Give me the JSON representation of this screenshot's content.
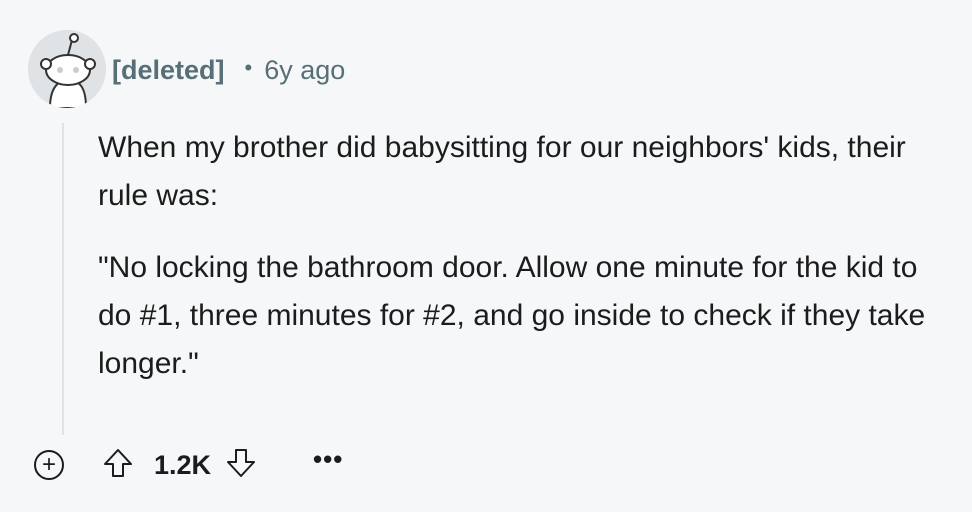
{
  "comment": {
    "author": "[deleted]",
    "separator": "•",
    "age": "6y ago",
    "paragraphs": [
      "When my brother did babysitting for our neighbors' kids, their rule was:",
      "\"No locking the bathroom door. Allow one minute for the kid to do #1, three minutes for #2, and go inside to check if they take longer.\""
    ],
    "score": "1.2K"
  },
  "actions": {
    "expand_symbol": "+",
    "more_symbol": "•••"
  },
  "icons": {
    "avatar": "snoo-avatar-icon",
    "upvote": "arrow-up-icon",
    "downvote": "arrow-down-icon"
  },
  "colors": {
    "background": "#f6f7f8",
    "meta_text": "#576f76",
    "body_text": "#1c1c1c",
    "thread_line": "#e0e3e6"
  }
}
